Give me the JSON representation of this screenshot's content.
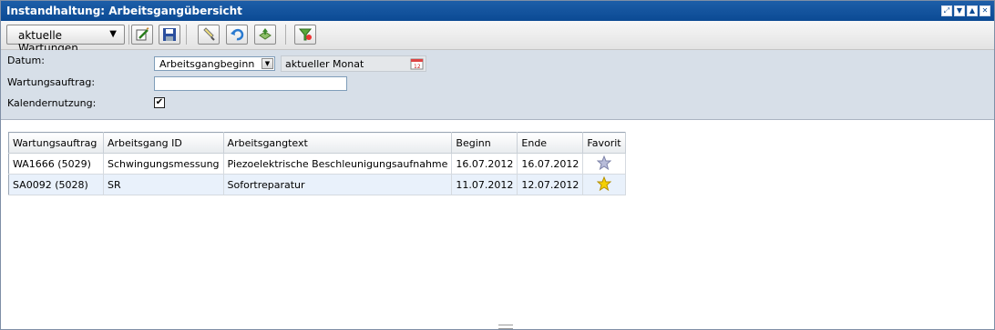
{
  "window": {
    "title": "Instandhaltung: Arbeitsgangübersicht",
    "controls": [
      "restore-icon",
      "down-icon",
      "up-icon",
      "close-icon"
    ]
  },
  "toolbar": {
    "view_dropdown": "aktuelle Wartungen",
    "buttons": [
      "edit-icon",
      "save-icon",
      "highlighter-icon",
      "undo-icon",
      "export-icon",
      "filter-icon"
    ]
  },
  "filter": {
    "date_label": "Datum:",
    "date_field_value": "Arbeitsgangbeginn",
    "period_value": "aktueller Monat",
    "order_label": "Wartungsauftrag:",
    "order_value": "",
    "calendar_label": "Kalendernutzung:",
    "calendar_checked": "✔"
  },
  "table": {
    "headers": [
      "Wartungsauftrag",
      "Arbeitsgang ID",
      "Arbeitsgangtext",
      "Beginn",
      "Ende",
      "Favorit"
    ],
    "rows": [
      {
        "order": "WA1666 (5029)",
        "op_id": "Schwingungsmessung",
        "text": "Piezoelektrische Beschleunigungsaufnahme",
        "start": "16.07.2012",
        "end": "16.07.2012",
        "favorite": "star-empty-icon"
      },
      {
        "order": "SA0092 (5028)",
        "op_id": "SR",
        "text": "Sofortreparatur",
        "start": "11.07.2012",
        "end": "12.07.2012",
        "favorite": "star-filled-icon"
      }
    ]
  },
  "colors": {
    "titlebar": "#0b4a94",
    "filter_background": "#d7dfe8",
    "alt_row": "#e9f1fb",
    "star_filled": "#f5d000",
    "star_empty": "#b8bcd9"
  }
}
